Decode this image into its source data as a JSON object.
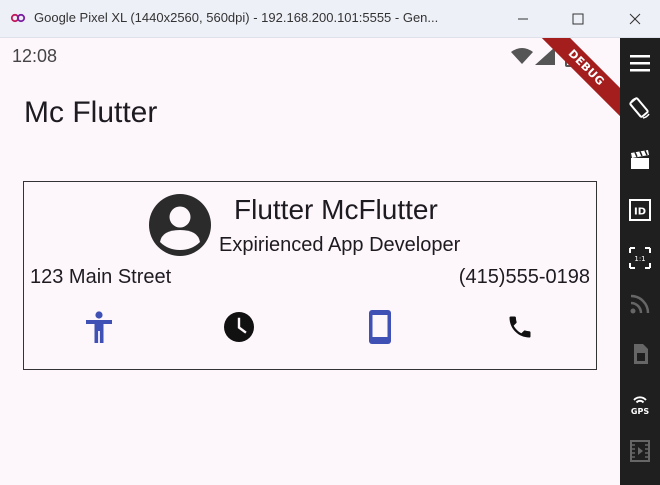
{
  "window": {
    "title": "Google Pixel XL (1440x2560, 560dpi) - 192.168.200.101:5555 - Gen...",
    "icon": "genymotion-icon"
  },
  "status_bar": {
    "time": "12:08",
    "debug_banner": "DEBUG"
  },
  "app_bar": {
    "title": "Mc Flutter"
  },
  "card": {
    "name": "Flutter McFlutter",
    "role": "Expirienced App Developer",
    "address": "123 Main Street",
    "phone": "(415)555-0198",
    "icons": [
      "accessibility-icon",
      "clock-icon",
      "smartphone-icon",
      "phone-icon"
    ],
    "accent_color": "#3f51b5"
  },
  "emulator_toolbar": {
    "items": [
      "menu-icon",
      "rotate-icon",
      "clapperboard-icon",
      "id-icon",
      "pixel-perfect-icon",
      "rss-icon",
      "sim-icon",
      "gps-icon",
      "video-icon"
    ],
    "labels": {
      "id": "ID",
      "pixel": "1:1",
      "gps": "GPS"
    }
  }
}
